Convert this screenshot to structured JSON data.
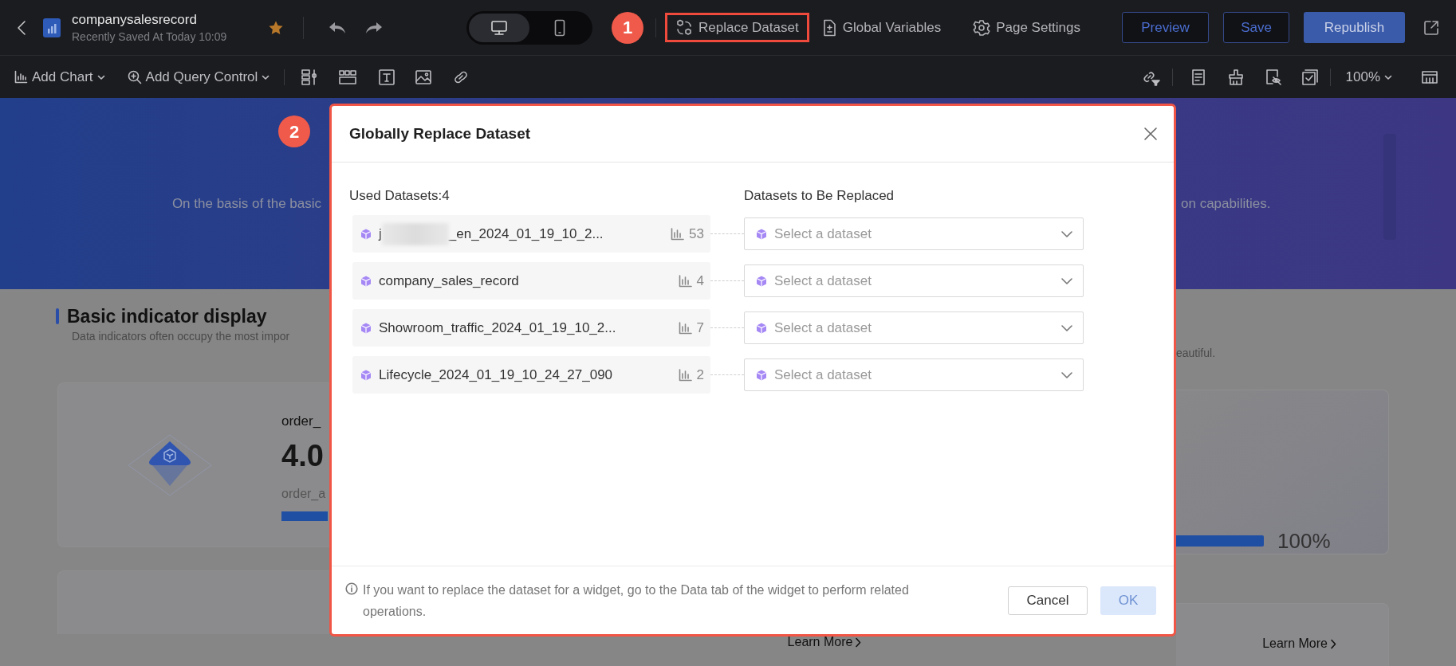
{
  "header": {
    "title": "companysalesrecord",
    "subtitle": "Recently Saved At Today 10:09",
    "starred": true,
    "device_modes": [
      {
        "kind": "desktop",
        "selected": true
      },
      {
        "kind": "mobile",
        "selected": false
      }
    ],
    "actions": [
      {
        "kind": "replace",
        "label": "Replace Dataset",
        "highlighted": true
      },
      {
        "kind": "variables",
        "label": "Global Variables",
        "highlighted": false
      },
      {
        "kind": "settings",
        "label": "Page Settings",
        "highlighted": false
      }
    ],
    "buttons": [
      {
        "label": "Preview",
        "kind": "outline"
      },
      {
        "label": "Save",
        "kind": "outline"
      },
      {
        "label": "Republish",
        "kind": "primary"
      }
    ]
  },
  "step_badges": [
    "1",
    "2"
  ],
  "toolbar": {
    "menus": [
      "Add Chart",
      "Add Query Control"
    ],
    "zoom": "100%"
  },
  "canvas": {
    "banner_text_left": "On the basis of the basic",
    "banner_text_right": "on capabilities.",
    "section_title": "Basic indicator display",
    "section_subtitle_left": "Data indicators often occupy the most impor",
    "section_subtitle_right": "eautiful.",
    "metric_label": "order_",
    "metric_value": "4.0",
    "metric_sub_label": "order_a",
    "progress": {
      "level": 1,
      "reading": "100%"
    },
    "links": [
      "Learn More",
      "Learn More"
    ]
  },
  "dialog": {
    "title": "Globally Replace Dataset",
    "used_heading": "Used Datasets:4",
    "target_heading": "Datasets to Be Replaced",
    "rows": [
      {
        "redacted_prefix": "j",
        "name": "_en_2024_01_19_10_2...",
        "count": "53",
        "placeholder": "Select a dataset"
      },
      {
        "name": "company_sales_record",
        "count": "4",
        "placeholder": "Select a dataset"
      },
      {
        "name": "Showroom_traffic_2024_01_19_10_2...",
        "count": "7",
        "placeholder": "Select a dataset"
      },
      {
        "name": "Lifecycle_2024_01_19_10_24_27_090",
        "count": "2",
        "placeholder": "Select a dataset"
      }
    ],
    "note": "If you want to replace the dataset for a widget, go to the Data tab of the widget to perform related operations.",
    "buttons": [
      {
        "label": "Cancel",
        "kind": "secondary",
        "disabled": false
      },
      {
        "label": "OK",
        "kind": "primary",
        "disabled": true
      }
    ]
  }
}
